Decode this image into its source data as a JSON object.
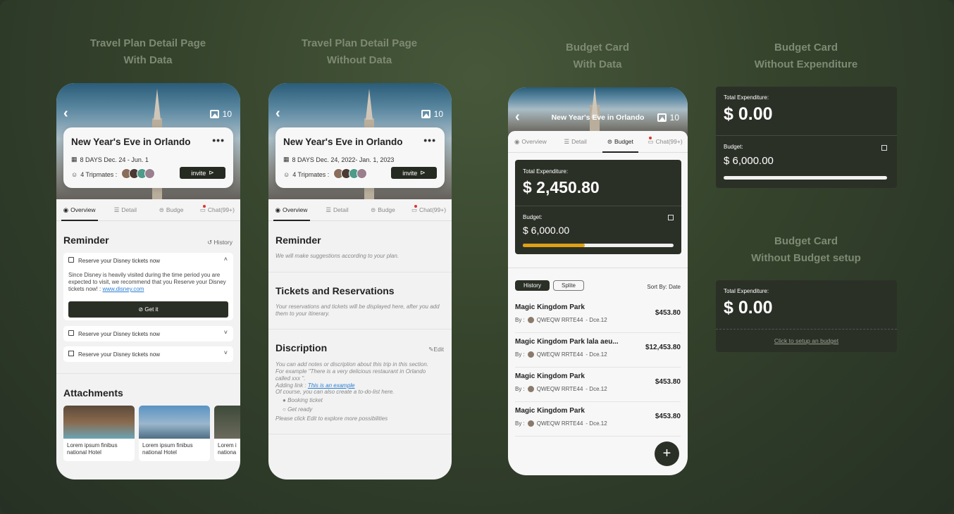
{
  "sections": [
    {
      "l1": "Travel Plan Detail Page",
      "l2": "With Data"
    },
    {
      "l1": "Travel Plan Detail Page",
      "l2": "Without Data"
    },
    {
      "l1": "Budget Card",
      "l2": "With Data"
    },
    {
      "l1": "Budget Card",
      "l2": "Without Expenditure"
    },
    {
      "l1": "Budget Card",
      "l2": "Without Budget setup"
    }
  ],
  "common": {
    "back": "‹",
    "gallery_count": "10",
    "trip_title": "New Year's Eve in Orlando",
    "more": "•••",
    "invite": "invite",
    "tripmates": "4 Tripmates :"
  },
  "tabs": [
    "Overview",
    "Detail",
    "Budge",
    "Chat(99+)"
  ],
  "p1": {
    "dates": "8 DAYS  Dec. 24 - Jun. 1",
    "reminder": "Reminder",
    "history": "History",
    "r1": "Reserve your Disney tickets now",
    "r1_body": "Since Disney is heavily visited during the time period you are expected to visit, we recommend that you Reserve your Disney tickets now! : ",
    "r1_link": "www.disney.com",
    "getit": "Get it",
    "r2": "Reserve your Disney tickets now",
    "r3": "Reserve your Disney tickets now",
    "attachments": "Attachments",
    "att": [
      "Lorem ipsum finibus national Hotel",
      "Lorem ipsum finibus national Hotel",
      "Lorem i nationa"
    ]
  },
  "p2": {
    "dates": "8 DAYS  Dec. 24, 2022- Jan. 1, 2023",
    "reminder": "Reminder",
    "reminder_empty": "We will make suggestions according to your plan.",
    "tickets": "Tickets and Reservations",
    "tickets_empty": "Your reservations and tickets will be displayed here, after you add them to your itinerary.",
    "discription": "Discription",
    "edit": "Edit",
    "d1": "You can add notes or discription about this trip in this section. For example \"There is a very delicious restaurant in Orlando called xxx \".",
    "d2": "Adding link : ",
    "d2_link": "This is an example",
    "d3": "Of course, you can also create a to-do-list here.",
    "todo1": "Booking ticket",
    "todo2": "Get ready",
    "d4": "Please click Edit to explore more possibilities"
  },
  "p3": {
    "title": "New Year's Eve in Orlando",
    "tabs": [
      "Overview",
      "Detail",
      "Budget",
      "Chat(99+)"
    ],
    "exp_label": "Total Expenditure:",
    "exp_value": "$ 2,450.80",
    "budget_label": "Budget:",
    "budget_value": "$ 6,000.00",
    "progress": 0.41,
    "history": "History",
    "splite": "Splite",
    "sort": "Sort By: Date",
    "items": [
      {
        "name": "Magic Kingdom Park",
        "by": "By :",
        "user": "QWEQW RRTE44",
        "date": "- Dce.12",
        "amount": "$453.80"
      },
      {
        "name": "Magic Kingdom Park lala aeu...",
        "by": "By :",
        "user": "QWEQW RRTE44",
        "date": "- Dce.12",
        "amount": "$12,453.80"
      },
      {
        "name": "Magic Kingdom Park",
        "by": "By :",
        "user": "QWEQW RRTE44",
        "date": "- Dce.12",
        "amount": "$453.80"
      },
      {
        "name": "Magic Kingdom Park",
        "by": "By :",
        "user": "QWEQW RRTE44",
        "date": "- Dce.12",
        "amount": "$453.80"
      }
    ],
    "fab": "+"
  },
  "c1": {
    "exp_label": "Total Expenditure:",
    "exp_value": "$ 0.00",
    "budget_label": "Budget:",
    "budget_value": "$ 6,000.00",
    "progress": 0
  },
  "c2": {
    "exp_label": "Total Expenditure:",
    "exp_value": "$ 0.00",
    "setup": "Click to setup an budget"
  },
  "colors": {
    "dark": "#2b3027",
    "accent": "#e0a015",
    "link": "#2a7fd4"
  }
}
